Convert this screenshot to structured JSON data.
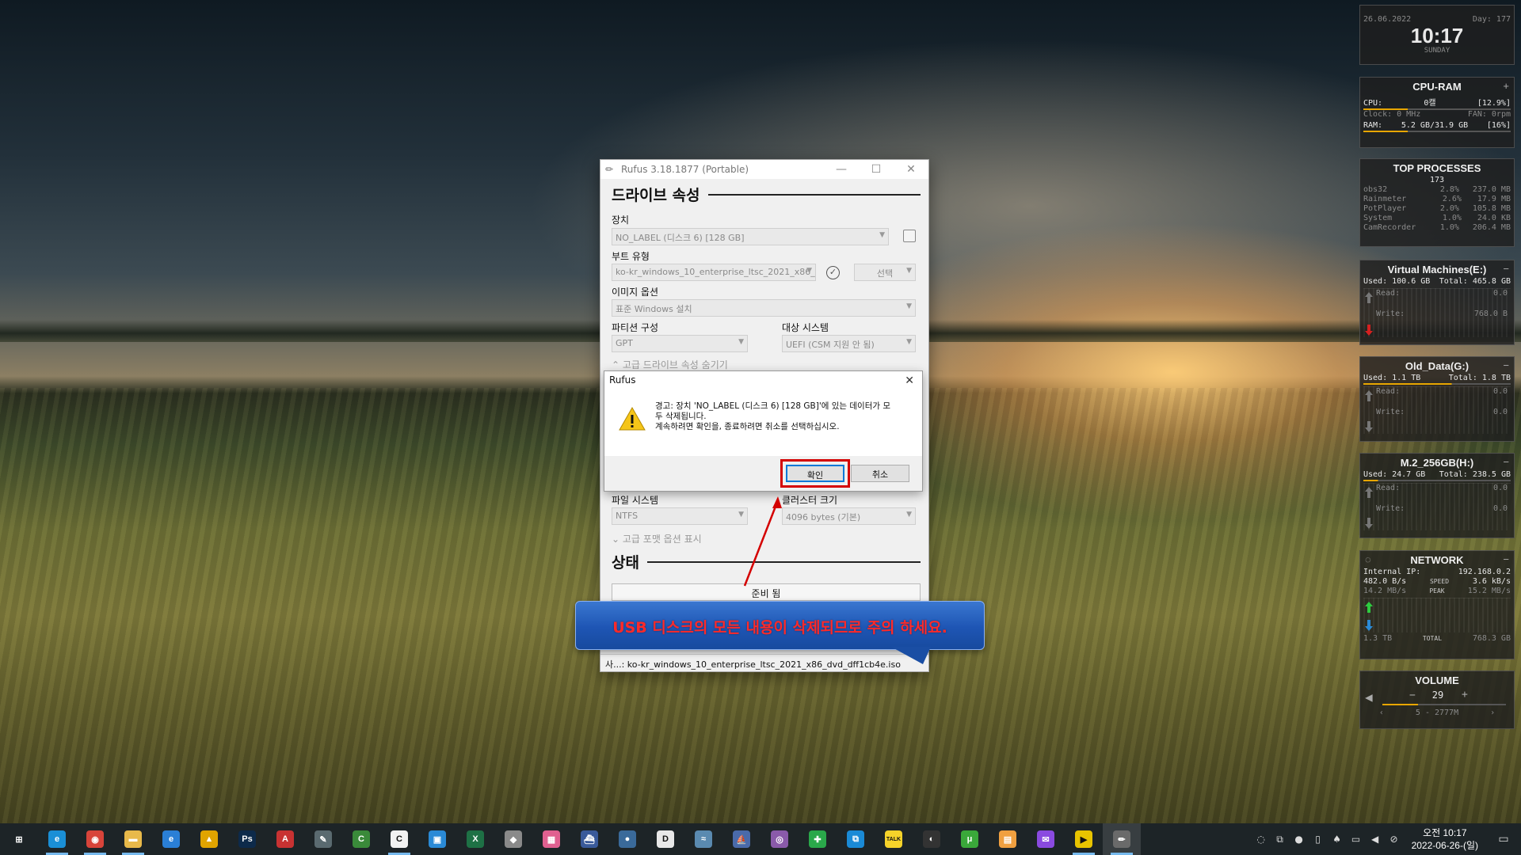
{
  "rufus": {
    "title": "Rufus 3.18.1877 (Portable)",
    "drive_section": "드라이브 속성",
    "device_label": "장치",
    "device_value": "NO_LABEL (디스크 6) [128 GB]",
    "boot_label": "부트 유형",
    "boot_value": "ko-kr_windows_10_enterprise_ltsc_2021_x86_",
    "select_button": "선택",
    "image_option_label": "이미지 옵션",
    "image_option_value": "표준 Windows 설치",
    "partition_label": "파티션 구성",
    "partition_value": "GPT",
    "target_label": "대상 시스템",
    "target_value": "UEFI (CSM 지원 안 됨)",
    "advanced_drive_toggle": "고급 드라이브 속성 숨기기",
    "filesystem_label": "파일 시스템",
    "filesystem_value": "NTFS",
    "cluster_label": "클러스터 크기",
    "cluster_value": "4096 bytes (기본)",
    "advanced_format_toggle": "고급 포맷 옵션 표시",
    "status_section": "상태",
    "status_text": "준비 됨",
    "footer_text": "사...: ko-kr_windows_10_enterprise_ltsc_2021_x86_dvd_dff1cb4e.iso"
  },
  "dialog": {
    "title": "Rufus",
    "message_line1": "경고: 장치 'NO_LABEL (디스크 6) [128 GB]'에 있는 데이터가 모",
    "message_line2": "두 삭제됩니다.",
    "message_line3": "계속하려면 확인을, 종료하려면 취소를 선택하십시오.",
    "ok_button": "확인",
    "cancel_button": "취소"
  },
  "annotation": {
    "text": "USB 디스크의 모든 내용이 삭제되므로 주의 하세요."
  },
  "widgets": {
    "clock": {
      "date": "26.06.2022",
      "day": "Day: 177",
      "time": "10:17",
      "weekday": "SUNDAY"
    },
    "cpu_ram": {
      "title": "CPU-RAM",
      "cpu_label": "CPU:",
      "cpu_temp": "0캘",
      "cpu_pct": "[12.9%]",
      "clock_label": "Clock: 0 MHz",
      "fan_label": "FAN: 0rpm",
      "ram_label": "RAM:",
      "ram_value": "5.2 GB/31.9 GB",
      "ram_pct": "[16%]"
    },
    "top_processes": {
      "title": "TOP PROCESSES",
      "count": "173",
      "rows": [
        {
          "name": "obs32",
          "cpu": "2.8%",
          "mem": "237.0 MB"
        },
        {
          "name": "Rainmeter",
          "cpu": "2.6%",
          "mem": "17.9 MB"
        },
        {
          "name": "PotPlayer",
          "cpu": "2.0%",
          "mem": "105.8 MB"
        },
        {
          "name": "System",
          "cpu": "1.0%",
          "mem": "24.0 KB"
        },
        {
          "name": "CamRecorder",
          "cpu": "1.0%",
          "mem": "206.4 MB"
        }
      ]
    },
    "disk_e": {
      "title": "Virtual Machines(E:)",
      "used": "Used: 100.6 GB",
      "total": "Total: 465.8 GB",
      "read": "Read:",
      "write": "Write:",
      "read_val": "0.0",
      "write_val": "768.0 B"
    },
    "disk_g": {
      "title": "Old_Data(G:)",
      "used": "Used: 1.1 TB",
      "total": "Total: 1.8 TB",
      "read": "Read:",
      "write": "Write:",
      "read_val": "0.0",
      "write_val": "0.0"
    },
    "disk_h": {
      "title": "M.2_256GB(H:)",
      "used": "Used: 24.7 GB",
      "total": "Total: 238.5 GB",
      "read": "Read:",
      "write": "Write:",
      "read_val": "0.0",
      "write_val": "0.0"
    },
    "network": {
      "title": "NETWORK",
      "ip_label": "Internal IP:",
      "ip_value": "192.168.0.2",
      "down_speed": "482.0 B/s",
      "speed_label": "SPEED",
      "up_speed": "3.6 kB/s",
      "down_peak": "14.2 MB/s",
      "peak_label": "PEAK",
      "up_peak": "15.2 MB/s",
      "total_down": "1.3 TB",
      "total_label": "TOTAL",
      "total_up": "768.3 GB"
    },
    "volume": {
      "title": "VOLUME",
      "minus": "−",
      "value": "29",
      "plus": "+",
      "device": "5 - 2777M"
    }
  },
  "taskbar": {
    "icons": [
      {
        "name": "start-icon",
        "glyph": "⊞",
        "color": "#1d2427"
      },
      {
        "name": "edge-icon",
        "glyph": "e",
        "color": "#1a8fd6"
      },
      {
        "name": "chrome-icon",
        "glyph": "◉",
        "color": "#d8443a"
      },
      {
        "name": "file-explorer-icon",
        "glyph": "▬",
        "color": "#e8b94a"
      },
      {
        "name": "internet-explorer-icon",
        "glyph": "e",
        "color": "#2a7fd6"
      },
      {
        "name": "app-triangle-icon",
        "glyph": "▲",
        "color": "#e0a400"
      },
      {
        "name": "photoshop-icon",
        "glyph": "Ps",
        "color": "#0d2a4a"
      },
      {
        "name": "pdf-app-icon",
        "glyph": "A",
        "color": "#c83232"
      },
      {
        "name": "tool-app-icon",
        "glyph": "✎",
        "color": "#5a6a70"
      },
      {
        "name": "c-app-green-icon",
        "glyph": "C",
        "color": "#3a8a3a"
      },
      {
        "name": "c-app-white-icon",
        "glyph": "C",
        "color": "#f2f2f2"
      },
      {
        "name": "remote-app-icon",
        "glyph": "▣",
        "color": "#2a8ad6"
      },
      {
        "name": "excel-icon",
        "glyph": "X",
        "color": "#1e7145"
      },
      {
        "name": "diamond-app-icon",
        "glyph": "◆",
        "color": "#8a8a8a"
      },
      {
        "name": "pink-app-icon",
        "glyph": "▦",
        "color": "#e06090"
      },
      {
        "name": "ship-app-icon",
        "glyph": "⛴",
        "color": "#3a5a9a"
      },
      {
        "name": "globe-app-icon",
        "glyph": "●",
        "color": "#3a6a9a"
      },
      {
        "name": "d-app-icon",
        "glyph": "D",
        "color": "#e8e8e8"
      },
      {
        "name": "fish-app-icon",
        "glyph": "≈",
        "color": "#5a8ab0"
      },
      {
        "name": "ship2-app-icon",
        "glyph": "⛵",
        "color": "#4a6aaa"
      },
      {
        "name": "media-app-icon",
        "glyph": "◎",
        "color": "#8a5aaa"
      },
      {
        "name": "green-arrows-icon",
        "glyph": "✚",
        "color": "#2aa84a"
      },
      {
        "name": "window-app-icon",
        "glyph": "⧉",
        "color": "#1a8ad6"
      },
      {
        "name": "talk-app-icon",
        "glyph": "TALK",
        "color": "#f6d32a"
      },
      {
        "name": "obs-icon",
        "glyph": "◐",
        "color": "#333"
      },
      {
        "name": "utorrent-icon",
        "glyph": "μ",
        "color": "#3aa83a"
      },
      {
        "name": "doc-app-icon",
        "glyph": "▤",
        "color": "#f0a040"
      },
      {
        "name": "messenger-icon",
        "glyph": "✉",
        "color": "#8a4ae0"
      },
      {
        "name": "potplayer-icon",
        "glyph": "▶",
        "color": "#e8c400"
      },
      {
        "name": "rufus-taskbar-icon",
        "glyph": "✏",
        "color": "#6a6a6a"
      }
    ],
    "tray_icons": [
      "◌",
      "⧉",
      "●",
      "▯",
      "♠",
      "▭",
      "◀",
      "⊘"
    ],
    "time": "오전 10:17",
    "date": "2022-06-26-(일)"
  },
  "colors": {
    "highlight": "#d40000",
    "callout_bg": "#1e55b4",
    "callout_text": "#ff2a2a",
    "primary_button_border": "#0078d7"
  }
}
